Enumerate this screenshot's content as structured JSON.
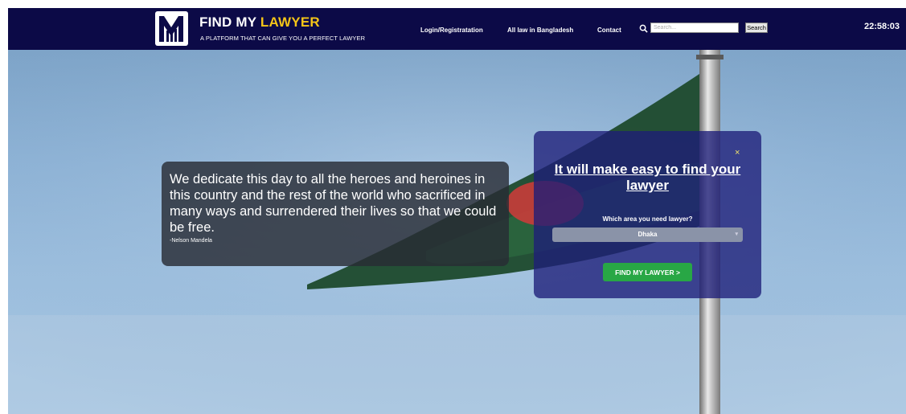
{
  "header": {
    "brand_main": "FIND MY ",
    "brand_accent": "LAWYER",
    "brand_subtitle": "A PLATFORM THAT CAN GIVE YOU A PERFECT LAWYER",
    "nav": [
      "Login/Registratation",
      "All law in Bangladesh",
      "Contact"
    ],
    "search_placeholder": "Search...",
    "search_button": "Search",
    "clock": "22:58:03"
  },
  "quote": {
    "text": "We dedicate this day to all the heroes and heroines in this country and the rest of the world who sacrificed in many ways and surrendered their lives so that we could be free.",
    "author": "-Nelson Mandela"
  },
  "modal": {
    "close": "×",
    "title": "It will make easy to find your lawyer",
    "label": "Which area you need lawyer?",
    "selected_area": "Dhaka",
    "button": "FIND MY LAWYER >"
  },
  "colors": {
    "navbar": "#0c0a47",
    "accent": "#f5c518",
    "button": "#28a745"
  }
}
